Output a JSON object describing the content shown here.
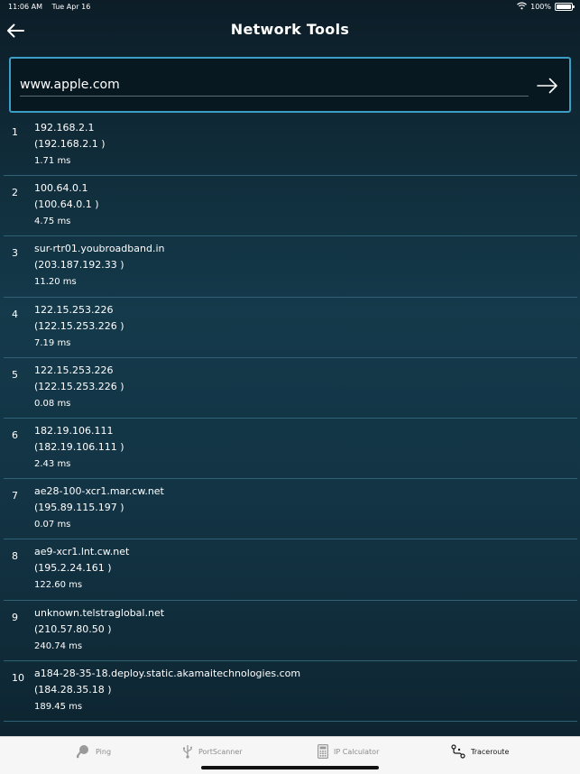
{
  "status_bar": {
    "time": "11:06 AM",
    "date": "Tue Apr 16",
    "battery": "100%",
    "battery_level": 1.0,
    "icons": [
      "wifi-icon",
      "battery-icon"
    ]
  },
  "nav": {
    "title": "Network Tools",
    "back_icon": "arrow-left-icon"
  },
  "search": {
    "value": "www.apple.com",
    "submit_icon": "arrow-right-icon"
  },
  "hops": [
    {
      "index": "1",
      "host": "192.168.2.1",
      "ip": "(192.168.2.1 )",
      "time": "1.71 ms"
    },
    {
      "index": "2",
      "host": "100.64.0.1",
      "ip": "(100.64.0.1 )",
      "time": "4.75 ms"
    },
    {
      "index": "3",
      "host": "sur-rtr01.youbroadband.in",
      "ip": "(203.187.192.33 )",
      "time": "11.20 ms"
    },
    {
      "index": "4",
      "host": "122.15.253.226",
      "ip": "(122.15.253.226 )",
      "time": "7.19 ms"
    },
    {
      "index": "5",
      "host": "122.15.253.226",
      "ip": "(122.15.253.226 )",
      "time": "0.08 ms"
    },
    {
      "index": "6",
      "host": "182.19.106.111",
      "ip": "(182.19.106.111 )",
      "time": "2.43 ms"
    },
    {
      "index": "7",
      "host": "ae28-100-xcr1.mar.cw.net",
      "ip": "(195.89.115.197 )",
      "time": "0.07 ms"
    },
    {
      "index": "8",
      "host": "ae9-xcr1.lnt.cw.net",
      "ip": "(195.2.24.161 )",
      "time": "122.60 ms"
    },
    {
      "index": "9",
      "host": "unknown.telstraglobal.net",
      "ip": "(210.57.80.50 )",
      "time": "240.74 ms"
    },
    {
      "index": "10",
      "host": "a184-28-35-18.deploy.static.akamaitechnologies.com",
      "ip": "(184.28.35.18 )",
      "time": "189.45 ms"
    }
  ],
  "tabs": [
    {
      "label": "Ping",
      "icon": "ping-icon",
      "active": false
    },
    {
      "label": "PortScanner",
      "icon": "usb-icon",
      "active": false
    },
    {
      "label": "IP Calculator",
      "icon": "calculator-icon",
      "active": false
    },
    {
      "label": "Traceroute",
      "icon": "route-icon",
      "active": true
    }
  ],
  "colors": {
    "accent_border": "#3a9ec6",
    "row_divider": "#2f6276",
    "tab_inactive": "#8c8c8c",
    "tab_active": "#1a1a1a"
  }
}
